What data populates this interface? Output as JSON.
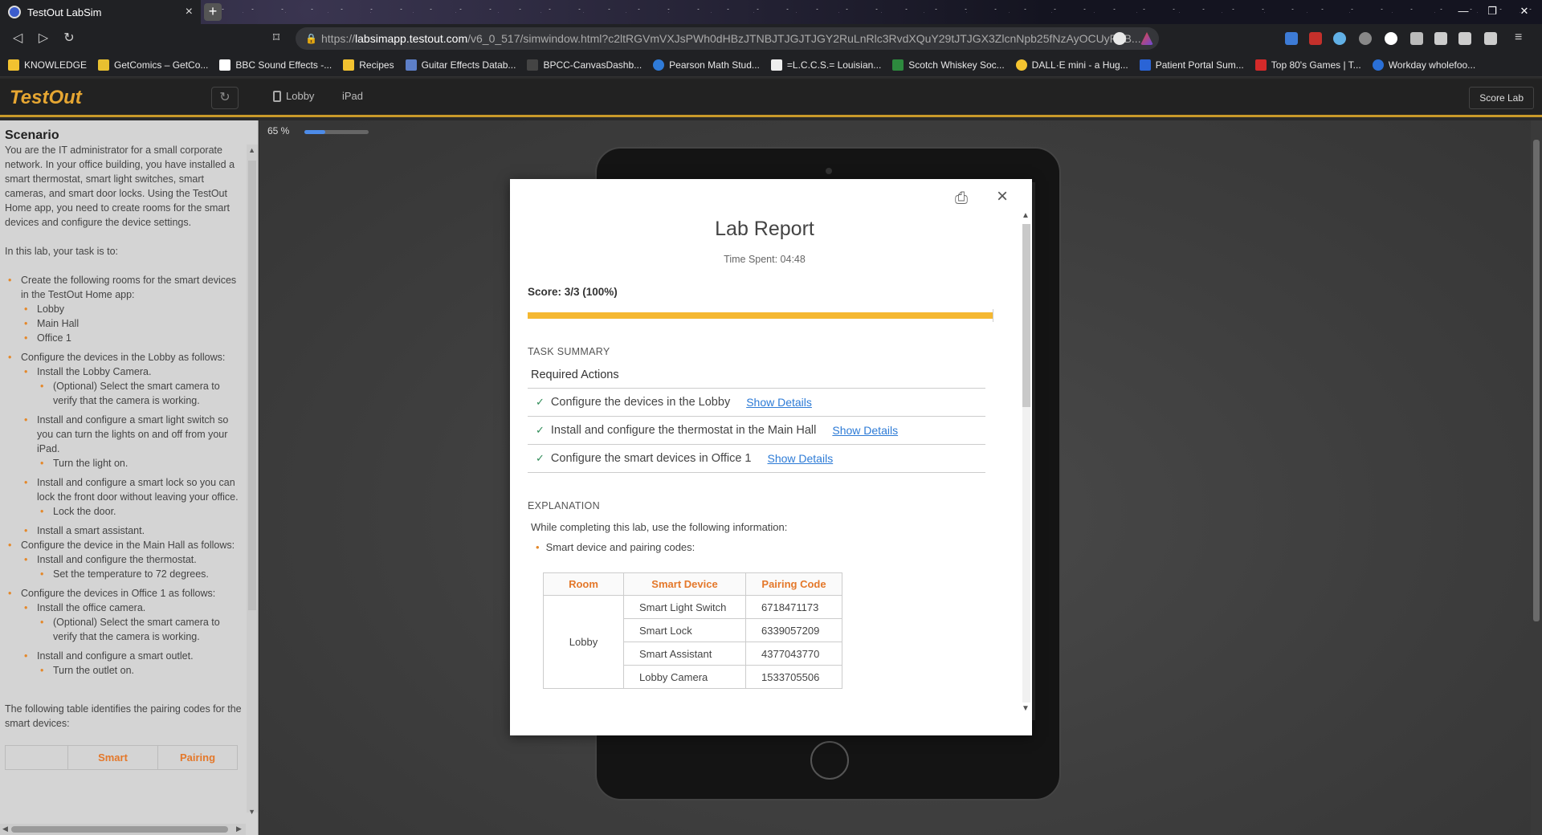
{
  "browser": {
    "tab_title": "TestOut LabSim",
    "url_prefix": "https://",
    "url_host": "labsimapp.testout.com",
    "url_path": "/v6_0_517/simwindow.html?c2ltRGVmVXJsPWh0dHBzJTNBJTJGJTJGY2RuLnRlc3RvdXQuY29tJTJGX3ZlcnNpb25fNzAyOCUyRnB...",
    "bookmarks": [
      "KNOWLEDGE",
      "GetComics – GetCo...",
      "BBC Sound Effects -...",
      "Recipes",
      "Guitar Effects Datab...",
      "BPCC-CanvasDashb...",
      "Pearson Math Stud...",
      "=L.C.C.S.= Louisian...",
      "Scotch Whiskey Soc...",
      "DALL·E mini - a Hug...",
      "Patient Portal Sum...",
      "Top 80's Games | T...",
      "Workday wholefoo..."
    ]
  },
  "app": {
    "logo": "TestOut",
    "crumb_lobby": "Lobby",
    "crumb_ipad": "iPad",
    "score_button": "Score Lab",
    "zoom_label": "65 %",
    "zoom_level": 0.33
  },
  "scenario": {
    "heading": "Scenario",
    "intro": "You are the IT administrator for a small corporate network. In your office building, you have installed a smart thermostat, smart light switches, smart cameras, and smart door locks. Using the TestOut Home app, you need to create rooms for the smart devices and configure the device settings.",
    "task_intro": "In this lab, your task is to:",
    "t1": "Create the following rooms for the smart devices in the TestOut Home app:",
    "t1a": "Lobby",
    "t1b": "Main Hall",
    "t1c": "Office 1",
    "t2": "Configure the devices in the Lobby as follows:",
    "t2a": "Install the Lobby Camera.",
    "t2a1": "(Optional) Select the smart camera to verify that the camera is working.",
    "t2b": "Install and configure a smart light switch so you can turn the lights on and off from your iPad.",
    "t2b1": "Turn the light on.",
    "t2c": "Install and configure a smart lock so you can lock the front door without leaving your office.",
    "t2c1": "Lock the door.",
    "t2d": "Install a smart assistant.",
    "t3": "Configure the device in the Main Hall as follows:",
    "t3a": "Install and configure the thermostat.",
    "t3a1": "Set the temperature to 72 degrees.",
    "t4": "Configure the devices in Office 1 as follows:",
    "t4a": "Install the office camera.",
    "t4a1": "(Optional) Select the smart camera to verify that the camera is working.",
    "t4b": "Install and configure a smart outlet.",
    "t4b1": "Turn the outlet on.",
    "table_intro": "The following table identifies the pairing codes for the smart devices:",
    "table_h2": "Smart",
    "table_h3": "Pairing"
  },
  "report": {
    "title": "Lab Report",
    "time_spent": "Time Spent: 04:48",
    "score": "Score: 3/3 (100%)",
    "score_fraction": 1.0,
    "task_summary": "TASK SUMMARY",
    "required_actions": "Required Actions",
    "tasks": [
      {
        "text": "Configure the devices in the Lobby",
        "link": "Show Details"
      },
      {
        "text": "Install and configure the thermostat in the Main Hall",
        "link": "Show Details"
      },
      {
        "text": "Configure the smart devices in Office 1",
        "link": "Show Details"
      }
    ],
    "explanation": "EXPLANATION",
    "explanation_text": "While completing this lab, use the following information:",
    "bullet": "Smart device and pairing codes:",
    "table": {
      "headers": [
        "Room",
        "Smart Device",
        "Pairing Code"
      ],
      "room": "Lobby",
      "rows": [
        {
          "device": "Smart Light Switch",
          "code": "6718471173"
        },
        {
          "device": "Smart Lock",
          "code": "6339057209"
        },
        {
          "device": "Smart Assistant",
          "code": "4377043770"
        },
        {
          "device": "Lobby Camera",
          "code": "1533705506"
        }
      ]
    }
  }
}
